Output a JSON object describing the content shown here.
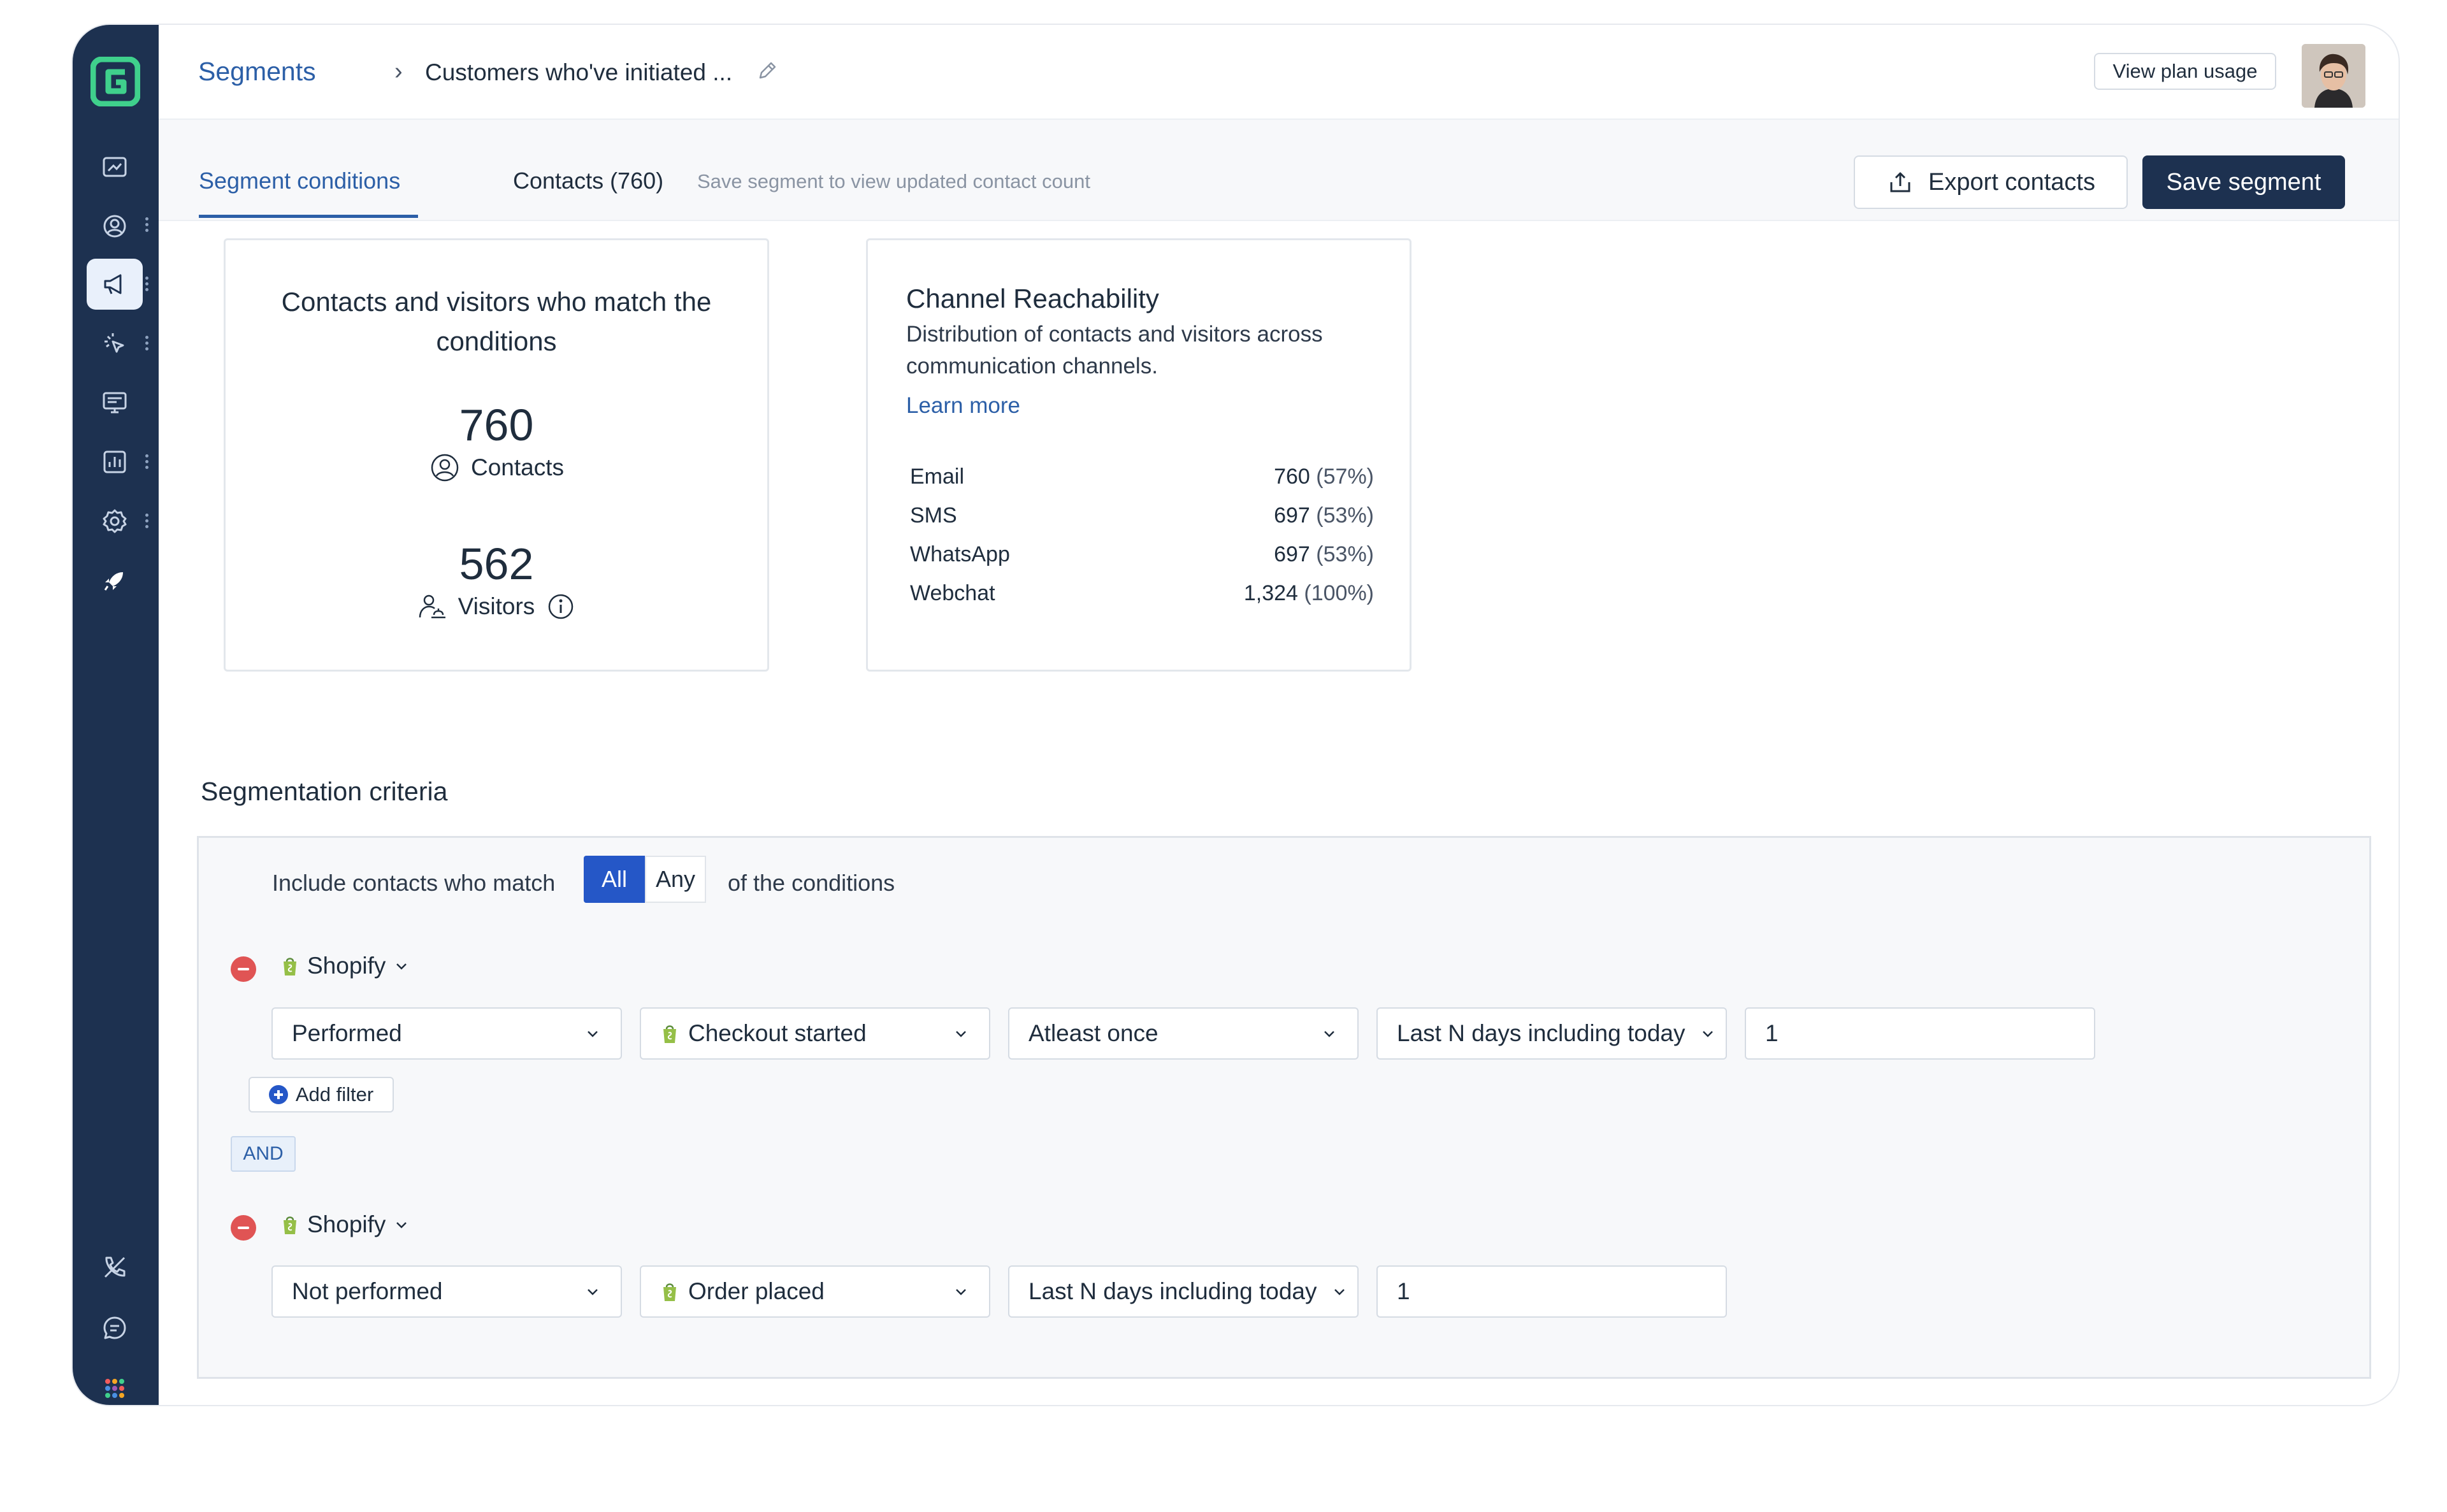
{
  "breadcrumb": {
    "root": "Segments",
    "separator": "›",
    "current": "Customers who've initiated ..."
  },
  "header": {
    "plan_button": "View plan usage"
  },
  "tabs": {
    "conditions": "Segment conditions",
    "contacts": "Contacts (760)",
    "hint": "Save segment to view updated contact count"
  },
  "actions": {
    "export": "Export contacts",
    "save": "Save segment"
  },
  "summary_card": {
    "title": "Contacts and visitors who match the conditions",
    "contacts_count": "760",
    "contacts_label": "Contacts",
    "visitors_count": "562",
    "visitors_label": "Visitors"
  },
  "reachability": {
    "title": "Channel Reachability",
    "description": "Distribution of contacts and visitors across communication channels.",
    "link": "Learn more",
    "rows": [
      {
        "channel": "Email",
        "count": "760",
        "pct": "(57%)"
      },
      {
        "channel": "SMS",
        "count": "697",
        "pct": "(53%)"
      },
      {
        "channel": "WhatsApp",
        "count": "697",
        "pct": "(53%)"
      },
      {
        "channel": "Webchat",
        "count": "1,324",
        "pct": "(100%)"
      }
    ]
  },
  "criteria": {
    "title": "Segmentation criteria",
    "match_prefix": "Include contacts who match",
    "match_all": "All",
    "match_any": "Any",
    "match_suffix": "of the conditions",
    "add_filter": "Add filter",
    "and_label": "AND",
    "groups": [
      {
        "source": "Shopify",
        "action": "Performed",
        "event": "Checkout started",
        "frequency": "Atleast once",
        "timeframe": "Last N days including today",
        "value": "1"
      },
      {
        "source": "Shopify",
        "action": "Not performed",
        "event": "Order placed",
        "timeframe": "Last N days including today",
        "value": "1"
      }
    ]
  },
  "colors": {
    "sidebar": "#1d3150",
    "accent": "#2c5fa7",
    "primary_button": "#1d3150",
    "all_toggle": "#2557c7",
    "remove": "#e05454",
    "shopify": "#95bf47"
  },
  "sidebar_icons": [
    "logo-icon",
    "dashboard-icon",
    "contacts-icon",
    "campaigns-icon",
    "automation-icon",
    "content-icon",
    "reports-icon",
    "settings-icon",
    "rocket-icon",
    "phone-icon",
    "chat-icon",
    "apps-grid-icon"
  ]
}
